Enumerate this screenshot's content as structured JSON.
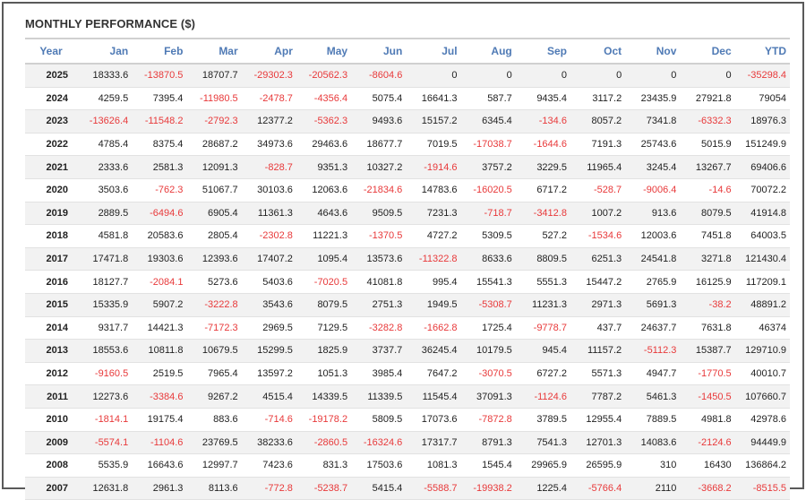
{
  "title": "MONTHLY PERFORMANCE ($)",
  "colors": {
    "header_text": "#4f7ab5",
    "negative": "#e8393a",
    "row_alt": "#f2f2f2"
  },
  "columns": [
    "Year",
    "Jan",
    "Feb",
    "Mar",
    "Apr",
    "May",
    "Jun",
    "Jul",
    "Aug",
    "Sep",
    "Oct",
    "Nov",
    "Dec",
    "YTD"
  ],
  "rows": [
    {
      "year": "2025",
      "values": [
        "18333.6",
        "-13870.5",
        "18707.7",
        "-29302.3",
        "-20562.3",
        "-8604.6",
        "0",
        "0",
        "0",
        "0",
        "0",
        "0",
        "-35298.4"
      ]
    },
    {
      "year": "2024",
      "values": [
        "4259.5",
        "7395.4",
        "-11980.5",
        "-2478.7",
        "-4356.4",
        "5075.4",
        "16641.3",
        "587.7",
        "9435.4",
        "3117.2",
        "23435.9",
        "27921.8",
        "79054"
      ]
    },
    {
      "year": "2023",
      "values": [
        "-13626.4",
        "-11548.2",
        "-2792.3",
        "12377.2",
        "-5362.3",
        "9493.6",
        "15157.2",
        "6345.4",
        "-134.6",
        "8057.2",
        "7341.8",
        "-6332.3",
        "18976.3"
      ]
    },
    {
      "year": "2022",
      "values": [
        "4785.4",
        "8375.4",
        "28687.2",
        "34973.6",
        "29463.6",
        "18677.7",
        "7019.5",
        "-17038.7",
        "-1644.6",
        "7191.3",
        "25743.6",
        "5015.9",
        "151249.9"
      ]
    },
    {
      "year": "2021",
      "values": [
        "2333.6",
        "2581.3",
        "12091.3",
        "-828.7",
        "9351.3",
        "10327.2",
        "-1914.6",
        "3757.2",
        "3229.5",
        "11965.4",
        "3245.4",
        "13267.7",
        "69406.6"
      ]
    },
    {
      "year": "2020",
      "values": [
        "3503.6",
        "-762.3",
        "51067.7",
        "30103.6",
        "12063.6",
        "-21834.6",
        "14783.6",
        "-16020.5",
        "6717.2",
        "-528.7",
        "-9006.4",
        "-14.6",
        "70072.2"
      ]
    },
    {
      "year": "2019",
      "values": [
        "2889.5",
        "-6494.6",
        "6905.4",
        "11361.3",
        "4643.6",
        "9509.5",
        "7231.3",
        "-718.7",
        "-3412.8",
        "1007.2",
        "913.6",
        "8079.5",
        "41914.8"
      ]
    },
    {
      "year": "2018",
      "values": [
        "4581.8",
        "20583.6",
        "2805.4",
        "-2302.8",
        "11221.3",
        "-1370.5",
        "4727.2",
        "5309.5",
        "527.2",
        "-1534.6",
        "12003.6",
        "7451.8",
        "64003.5"
      ]
    },
    {
      "year": "2017",
      "values": [
        "17471.8",
        "19303.6",
        "12393.6",
        "17407.2",
        "1095.4",
        "13573.6",
        "-11322.8",
        "8633.6",
        "8809.5",
        "6251.3",
        "24541.8",
        "3271.8",
        "121430.4"
      ]
    },
    {
      "year": "2016",
      "values": [
        "18127.7",
        "-2084.1",
        "5273.6",
        "5403.6",
        "-7020.5",
        "41081.8",
        "995.4",
        "15541.3",
        "5551.3",
        "15447.2",
        "2765.9",
        "16125.9",
        "117209.1"
      ]
    },
    {
      "year": "2015",
      "values": [
        "15335.9",
        "5907.2",
        "-3222.8",
        "3543.6",
        "8079.5",
        "2751.3",
        "1949.5",
        "-5308.7",
        "11231.3",
        "2971.3",
        "5691.3",
        "-38.2",
        "48891.2"
      ]
    },
    {
      "year": "2014",
      "values": [
        "9317.7",
        "14421.3",
        "-7172.3",
        "2969.5",
        "7129.5",
        "-3282.8",
        "-1662.8",
        "1725.4",
        "-9778.7",
        "437.7",
        "24637.7",
        "7631.8",
        "46374"
      ]
    },
    {
      "year": "2013",
      "values": [
        "18553.6",
        "10811.8",
        "10679.5",
        "15299.5",
        "1825.9",
        "3737.7",
        "36245.4",
        "10179.5",
        "945.4",
        "11157.2",
        "-5112.3",
        "15387.7",
        "129710.9"
      ]
    },
    {
      "year": "2012",
      "values": [
        "-9160.5",
        "2519.5",
        "7965.4",
        "13597.2",
        "1051.3",
        "3985.4",
        "7647.2",
        "-3070.5",
        "6727.2",
        "5571.3",
        "4947.7",
        "-1770.5",
        "40010.7"
      ]
    },
    {
      "year": "2011",
      "values": [
        "12273.6",
        "-3384.6",
        "9267.2",
        "4515.4",
        "14339.5",
        "11339.5",
        "11545.4",
        "37091.3",
        "-1124.6",
        "7787.2",
        "5461.3",
        "-1450.5",
        "107660.7"
      ]
    },
    {
      "year": "2010",
      "values": [
        "-1814.1",
        "19175.4",
        "883.6",
        "-714.6",
        "-19178.2",
        "5809.5",
        "17073.6",
        "-7872.8",
        "3789.5",
        "12955.4",
        "7889.5",
        "4981.8",
        "42978.6"
      ]
    },
    {
      "year": "2009",
      "values": [
        "-5574.1",
        "-1104.6",
        "23769.5",
        "38233.6",
        "-2860.5",
        "-16324.6",
        "17317.7",
        "8791.3",
        "7541.3",
        "12701.3",
        "14083.6",
        "-2124.6",
        "94449.9"
      ]
    },
    {
      "year": "2008",
      "values": [
        "5535.9",
        "16643.6",
        "12997.7",
        "7423.6",
        "831.3",
        "17503.6",
        "1081.3",
        "1545.4",
        "29965.9",
        "26595.9",
        "310",
        "16430",
        "136864.2"
      ]
    },
    {
      "year": "2007",
      "values": [
        "12631.8",
        "2961.3",
        "8113.6",
        "-772.8",
        "-5238.7",
        "5415.4",
        "-5588.7",
        "-19938.2",
        "1225.4",
        "-5766.4",
        "2110",
        "-3668.2",
        "-8515.5"
      ]
    }
  ]
}
